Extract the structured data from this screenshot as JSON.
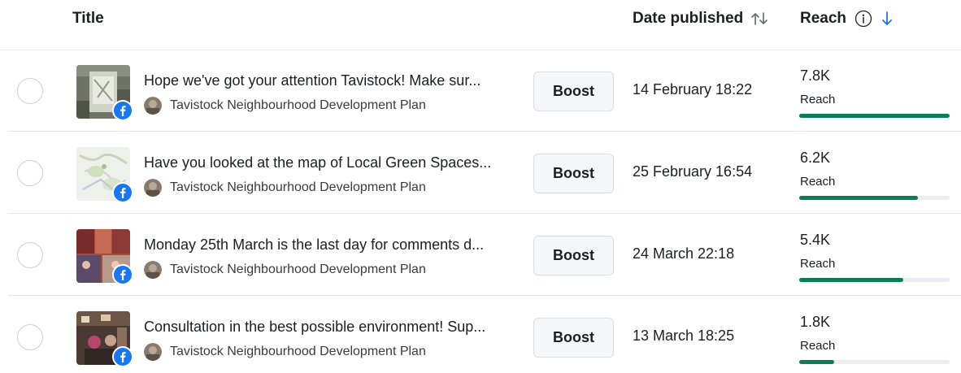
{
  "header": {
    "title": "Title",
    "date_published": "Date published",
    "reach": "Reach"
  },
  "colors": {
    "reach_bar": "#0a7d55",
    "reach_track": "#ebedf0",
    "facebook_blue": "#1877f2",
    "sort_arrow_active": "#1877f2"
  },
  "icons": {
    "sort_toggle": "sort-up-down-icon",
    "info": "info-icon",
    "sort_active": "arrow-down-icon",
    "platform_badge": "facebook-icon"
  },
  "posts": [
    {
      "title": "Hope we've got your attention Tavistock! Make sur...",
      "page_name": "Tavistock Neighbourhood Development Plan",
      "boost_label": "Boost",
      "date": "14 February 18:22",
      "reach_value": "7.8K",
      "reach_label": "Reach",
      "reach_fraction": 1.0
    },
    {
      "title": "Have you looked at the map of Local Green Spaces...",
      "page_name": "Tavistock Neighbourhood Development Plan",
      "boost_label": "Boost",
      "date": "25 February 16:54",
      "reach_value": "6.2K",
      "reach_label": "Reach",
      "reach_fraction": 0.79
    },
    {
      "title": "Monday 25th March is the last day for comments d...",
      "page_name": "Tavistock Neighbourhood Development Plan",
      "boost_label": "Boost",
      "date": "24 March 22:18",
      "reach_value": "5.4K",
      "reach_label": "Reach",
      "reach_fraction": 0.69
    },
    {
      "title": "Consultation in the best possible environment! Sup...",
      "page_name": "Tavistock Neighbourhood Development Plan",
      "boost_label": "Boost",
      "date": "13 March 18:25",
      "reach_value": "1.8K",
      "reach_label": "Reach",
      "reach_fraction": 0.23
    }
  ]
}
